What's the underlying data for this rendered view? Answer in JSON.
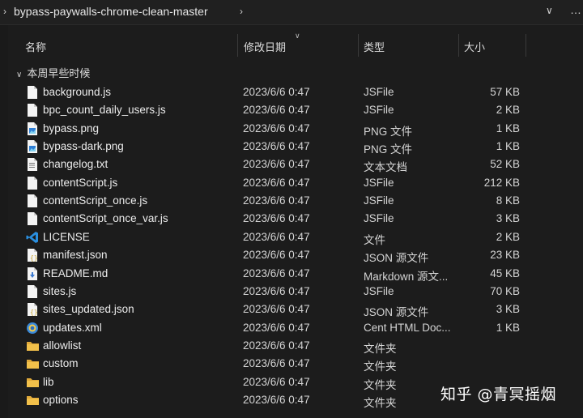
{
  "breadcrumb": {
    "folder": "bypass-paywalls-chrome-clean-master"
  },
  "columns": {
    "name": "名称",
    "date": "修改日期",
    "type": "类型",
    "size": "大小"
  },
  "group": {
    "label": "本周早些时候"
  },
  "files": [
    {
      "name": "background.js",
      "date": "2023/6/6 0:47",
      "type": "JSFile",
      "size": "57 KB",
      "icon": "js-file-icon"
    },
    {
      "name": "bpc_count_daily_users.js",
      "date": "2023/6/6 0:47",
      "type": "JSFile",
      "size": "2 KB",
      "icon": "js-file-icon"
    },
    {
      "name": "bypass.png",
      "date": "2023/6/6 0:47",
      "type": "PNG 文件",
      "size": "1 KB",
      "icon": "image-file-icon"
    },
    {
      "name": "bypass-dark.png",
      "date": "2023/6/6 0:47",
      "type": "PNG 文件",
      "size": "1 KB",
      "icon": "image-file-icon"
    },
    {
      "name": "changelog.txt",
      "date": "2023/6/6 0:47",
      "type": "文本文档",
      "size": "52 KB",
      "icon": "text-file-icon"
    },
    {
      "name": "contentScript.js",
      "date": "2023/6/6 0:47",
      "type": "JSFile",
      "size": "212 KB",
      "icon": "js-file-icon"
    },
    {
      "name": "contentScript_once.js",
      "date": "2023/6/6 0:47",
      "type": "JSFile",
      "size": "8 KB",
      "icon": "js-file-icon"
    },
    {
      "name": "contentScript_once_var.js",
      "date": "2023/6/6 0:47",
      "type": "JSFile",
      "size": "3 KB",
      "icon": "js-file-icon"
    },
    {
      "name": "LICENSE",
      "date": "2023/6/6 0:47",
      "type": "文件",
      "size": "2 KB",
      "icon": "vscode-icon"
    },
    {
      "name": "manifest.json",
      "date": "2023/6/6 0:47",
      "type": "JSON 源文件",
      "size": "23 KB",
      "icon": "json-file-icon"
    },
    {
      "name": "README.md",
      "date": "2023/6/6 0:47",
      "type": "Markdown 源文...",
      "size": "45 KB",
      "icon": "markdown-file-icon"
    },
    {
      "name": "sites.js",
      "date": "2023/6/6 0:47",
      "type": "JSFile",
      "size": "70 KB",
      "icon": "js-file-icon"
    },
    {
      "name": "sites_updated.json",
      "date": "2023/6/6 0:47",
      "type": "JSON 源文件",
      "size": "3 KB",
      "icon": "json-file-icon"
    },
    {
      "name": "updates.xml",
      "date": "2023/6/6 0:47",
      "type": "Cent HTML Doc...",
      "size": "1 KB",
      "icon": "browser-file-icon"
    },
    {
      "name": "allowlist",
      "date": "2023/6/6 0:47",
      "type": "文件夹",
      "size": "",
      "icon": "folder-icon"
    },
    {
      "name": "custom",
      "date": "2023/6/6 0:47",
      "type": "文件夹",
      "size": "",
      "icon": "folder-icon"
    },
    {
      "name": "lib",
      "date": "2023/6/6 0:47",
      "type": "文件夹",
      "size": "",
      "icon": "folder-icon"
    },
    {
      "name": "options",
      "date": "2023/6/6 0:47",
      "type": "文件夹",
      "size": "",
      "icon": "folder-icon"
    }
  ],
  "watermark": {
    "text": "知乎 @青冥摇烟"
  },
  "colors": {
    "background": "#1c1c1c",
    "folder": "#f2c04a",
    "vscode_blue": "#2a8fe0"
  }
}
